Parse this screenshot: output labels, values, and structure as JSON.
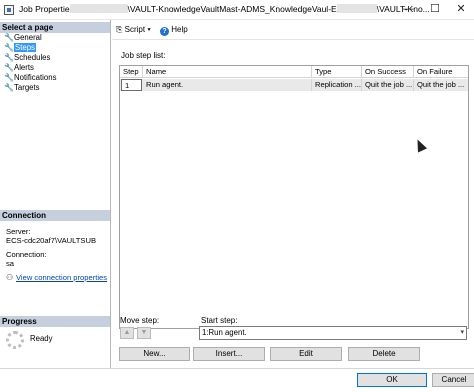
{
  "window": {
    "title_prefix": "Job Propertie",
    "title_middle": "\\VAULT-KnowledgeVaultMast-ADMS_KnowledgeVaul-E",
    "title_suffix": "\\VAULT-Kno...",
    "minimize": "—",
    "maximize": "☐",
    "close": "✕"
  },
  "sidebar": {
    "select_header": "Select a page",
    "pages": [
      {
        "label": "General"
      },
      {
        "label": "Steps"
      },
      {
        "label": "Schedules"
      },
      {
        "label": "Alerts"
      },
      {
        "label": "Notifications"
      },
      {
        "label": "Targets"
      }
    ],
    "connection_header": "Connection",
    "server_label": "Server:",
    "server_value": "ECS-cdc20af7\\VAULTSUB",
    "conn_label": "Connection:",
    "conn_value": "sa",
    "view_props": "View connection properties",
    "progress_header": "Progress",
    "progress_status": "Ready"
  },
  "toolbar": {
    "script": "Script",
    "help": "Help"
  },
  "steps": {
    "list_label": "Job step list:",
    "columns": [
      "Step",
      "Name",
      "Type",
      "On Success",
      "On Failure"
    ],
    "rows": [
      {
        "step": "1",
        "name": "Run agent.",
        "type": "Replication ...",
        "on_success": "Quit the job ...",
        "on_failure": "Quit the job ..."
      }
    ],
    "move_label": "Move step:",
    "start_label": "Start step:",
    "start_value": "1:Run agent."
  },
  "buttons": {
    "new": "New...",
    "insert": "Insert...",
    "edit": "Edit",
    "delete": "Delete",
    "ok": "OK",
    "cancel": "Cancel"
  },
  "colors": {
    "section_header": "#c6cfde",
    "selection": "#3399ff",
    "link": "#0645ad"
  }
}
